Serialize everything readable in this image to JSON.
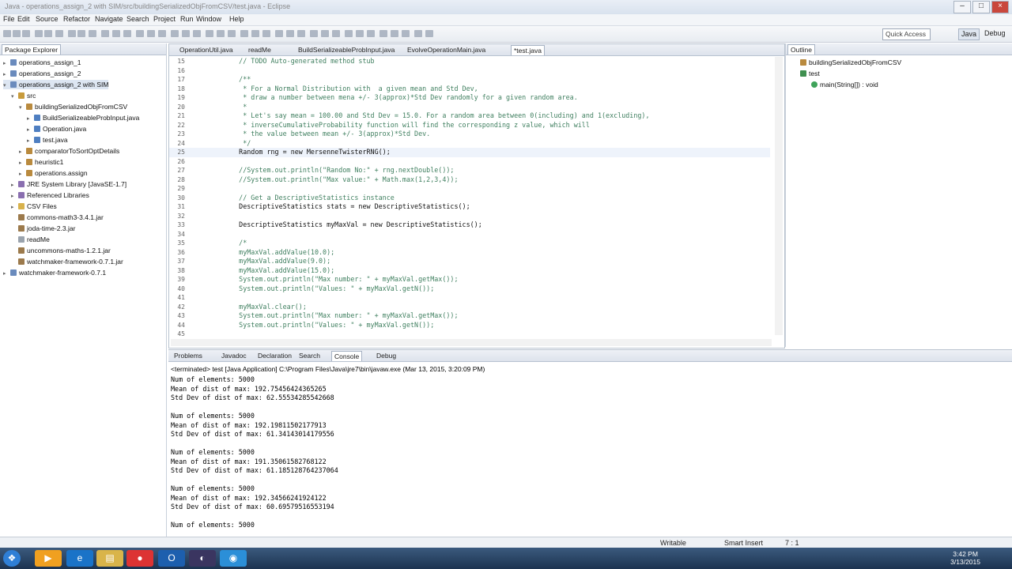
{
  "window": {
    "title": "Java - operations_assign_2 with SIM/src/buildingSerializedObjFromCSV/test.java - Eclipse"
  },
  "menu": [
    "File",
    "Edit",
    "Source",
    "Refactor",
    "Navigate",
    "Search",
    "Project",
    "Run",
    "Window",
    "Help"
  ],
  "toolbar": {
    "quick_access": "Quick Access",
    "perspectives": [
      "Java",
      "Debug"
    ]
  },
  "package_explorer": {
    "tab": "Package Explorer",
    "items": [
      {
        "label": "operations_assign_1",
        "depth": 0,
        "icon": "project-icon",
        "toggle": "▸"
      },
      {
        "label": "operations_assign_2",
        "depth": 0,
        "icon": "project-icon",
        "toggle": "▸"
      },
      {
        "label": "operations_assign_2 with SIM",
        "depth": 0,
        "icon": "project-icon",
        "toggle": "▾"
      },
      {
        "label": "src",
        "depth": 1,
        "icon": "source-folder-icon",
        "toggle": "▾"
      },
      {
        "label": "buildingSerializedObjFromCSV",
        "depth": 2,
        "icon": "package-icon",
        "toggle": "▾"
      },
      {
        "label": "BuildSerializeableProbInput.java",
        "depth": 3,
        "icon": "java-file-icon",
        "toggle": "▸"
      },
      {
        "label": "Operation.java",
        "depth": 3,
        "icon": "java-file-icon",
        "toggle": "▸"
      },
      {
        "label": "test.java",
        "depth": 3,
        "icon": "java-file-icon",
        "toggle": "▸"
      },
      {
        "label": "comparatorToSortOptDetails",
        "depth": 2,
        "icon": "package-icon",
        "toggle": "▸"
      },
      {
        "label": "heuristic1",
        "depth": 2,
        "icon": "package-icon",
        "toggle": "▸"
      },
      {
        "label": "operations.assign",
        "depth": 2,
        "icon": "package-icon",
        "toggle": "▸"
      },
      {
        "label": "JRE System Library [JavaSE-1.7]",
        "depth": 1,
        "icon": "library-icon",
        "toggle": "▸"
      },
      {
        "label": "Referenced Libraries",
        "depth": 1,
        "icon": "library-icon",
        "toggle": "▸"
      },
      {
        "label": "CSV Files",
        "depth": 1,
        "icon": "folder-icon",
        "toggle": "▸"
      },
      {
        "label": "commons-math3-3.4.1.jar",
        "depth": 1,
        "icon": "jar-icon",
        "toggle": ""
      },
      {
        "label": "joda-time-2.3.jar",
        "depth": 1,
        "icon": "jar-icon",
        "toggle": ""
      },
      {
        "label": "readMe",
        "depth": 1,
        "icon": "file-icon",
        "toggle": ""
      },
      {
        "label": "uncommons-maths-1.2.1.jar",
        "depth": 1,
        "icon": "jar-icon",
        "toggle": ""
      },
      {
        "label": "watchmaker-framework-0.7.1.jar",
        "depth": 1,
        "icon": "jar-icon",
        "toggle": ""
      },
      {
        "label": "watchmaker-framework-0.7.1",
        "depth": 0,
        "icon": "project-icon",
        "toggle": "▸"
      }
    ]
  },
  "editor": {
    "tabs": [
      {
        "label": "OperationUtil.java",
        "active": false
      },
      {
        "label": "readMe",
        "active": false
      },
      {
        "label": "BuildSerializeableProbInput.java",
        "active": false
      },
      {
        "label": "EvolveOperationMain.java",
        "active": false
      },
      {
        "label": "*test.java",
        "active": true
      }
    ],
    "lines": [
      {
        "n": "15",
        "t": "    // TODO Auto-generated method stub",
        "c": "comment"
      },
      {
        "n": "16",
        "t": "",
        "c": ""
      },
      {
        "n": "17",
        "t": "    /**",
        "c": "comment"
      },
      {
        "n": "18",
        "t": "     * For a Normal Distribution with  a given mean and Std Dev,",
        "c": "comment"
      },
      {
        "n": "19",
        "t": "     * draw a number between mena +/- 3(approx)*Std Dev randomly for a given random area.",
        "c": "comment"
      },
      {
        "n": "20",
        "t": "     *",
        "c": "comment"
      },
      {
        "n": "21",
        "t": "     * Let's say mean = 100.00 and Std Dev = 15.0. For a random area between 0(including) and 1(excluding),",
        "c": "comment"
      },
      {
        "n": "22",
        "t": "     * inverseCumulativeProbability function will find the corresponding z value, which will",
        "c": "comment"
      },
      {
        "n": "23",
        "t": "     * the value between mean +/- 3(approx)*Std Dev.",
        "c": "comment"
      },
      {
        "n": "24",
        "t": "     */",
        "c": "comment"
      },
      {
        "n": "25",
        "t": "    Random rng = new MersenneTwisterRNG();",
        "c": ""
      },
      {
        "n": "26",
        "t": "",
        "c": ""
      },
      {
        "n": "27",
        "t": "    //System.out.println(\"Random No:\" + rng.nextDouble());",
        "c": "comment"
      },
      {
        "n": "28",
        "t": "    //System.out.println(\"Max value:\" + Math.max(1,2,3,4));",
        "c": "comment"
      },
      {
        "n": "29",
        "t": "",
        "c": ""
      },
      {
        "n": "30",
        "t": "    // Get a DescriptiveStatistics instance",
        "c": "comment"
      },
      {
        "n": "31",
        "t": "    DescriptiveStatistics stats = new DescriptiveStatistics();",
        "c": ""
      },
      {
        "n": "32",
        "t": "",
        "c": ""
      },
      {
        "n": "33",
        "t": "    DescriptiveStatistics myMaxVal = new DescriptiveStatistics();",
        "c": ""
      },
      {
        "n": "34",
        "t": "",
        "c": ""
      },
      {
        "n": "35",
        "t": "    /*",
        "c": "comment"
      },
      {
        "n": "36",
        "t": "    myMaxVal.addValue(10.0);",
        "c": "comment"
      },
      {
        "n": "37",
        "t": "    myMaxVal.addValue(9.0);",
        "c": "comment"
      },
      {
        "n": "38",
        "t": "    myMaxVal.addValue(15.0);",
        "c": "comment"
      },
      {
        "n": "39",
        "t": "    System.out.println(\"Max number: \" + myMaxVal.getMax());",
        "c": "comment"
      },
      {
        "n": "40",
        "t": "    System.out.println(\"Values: \" + myMaxVal.getN());",
        "c": "comment"
      },
      {
        "n": "41",
        "t": "",
        "c": ""
      },
      {
        "n": "42",
        "t": "    myMaxVal.clear();",
        "c": "comment"
      },
      {
        "n": "43",
        "t": "    System.out.println(\"Max number: \" + myMaxVal.getMax());",
        "c": "comment"
      },
      {
        "n": "44",
        "t": "    System.out.println(\"Values: \" + myMaxVal.getN());",
        "c": "comment"
      },
      {
        "n": "45",
        "t": "",
        "c": ""
      }
    ]
  },
  "outline": {
    "tab": "Outline",
    "items": [
      {
        "label": "buildingSerializedObjFromCSV",
        "depth": 0,
        "icon": "package-icon"
      },
      {
        "label": "test",
        "depth": 0,
        "icon": "class-icon"
      },
      {
        "label": "main(String[]) : void",
        "depth": 1,
        "icon": "method-icon"
      }
    ]
  },
  "console": {
    "tabs": [
      {
        "label": "Problems",
        "active": false
      },
      {
        "label": "Javadoc",
        "active": false
      },
      {
        "label": "Declaration",
        "active": false
      },
      {
        "label": "Search",
        "active": false
      },
      {
        "label": "Console",
        "active": true
      },
      {
        "label": "Debug",
        "active": false
      }
    ],
    "header": "<terminated> test [Java Application] C:\\Program Files\\Java\\jre7\\bin\\javaw.exe (Mar 13, 2015, 3:20:09 PM)",
    "lines": [
      "Num of elements: 5000",
      "Mean of dist of max: 192.75456424365265",
      "Std Dev of dist of max: 62.55534285542668",
      "",
      "Num of elements: 5000",
      "Mean of dist of max: 192.19811502177913",
      "Std Dev of dist of max: 61.34143014179556",
      "",
      "Num of elements: 5000",
      "Mean of dist of max: 191.35061582768122",
      "Std Dev of dist of max: 61.185128764237064",
      "",
      "Num of elements: 5000",
      "Mean of dist of max: 192.34566241924122",
      "Std Dev of dist of max: 60.69579516553194",
      "",
      "Num of elements: 5000"
    ]
  },
  "status": {
    "writable": "Writable",
    "insert_mode": "Smart Insert",
    "position": "7 : 1"
  },
  "clock": {
    "time": "3:42 PM",
    "date": "3/13/2015"
  }
}
